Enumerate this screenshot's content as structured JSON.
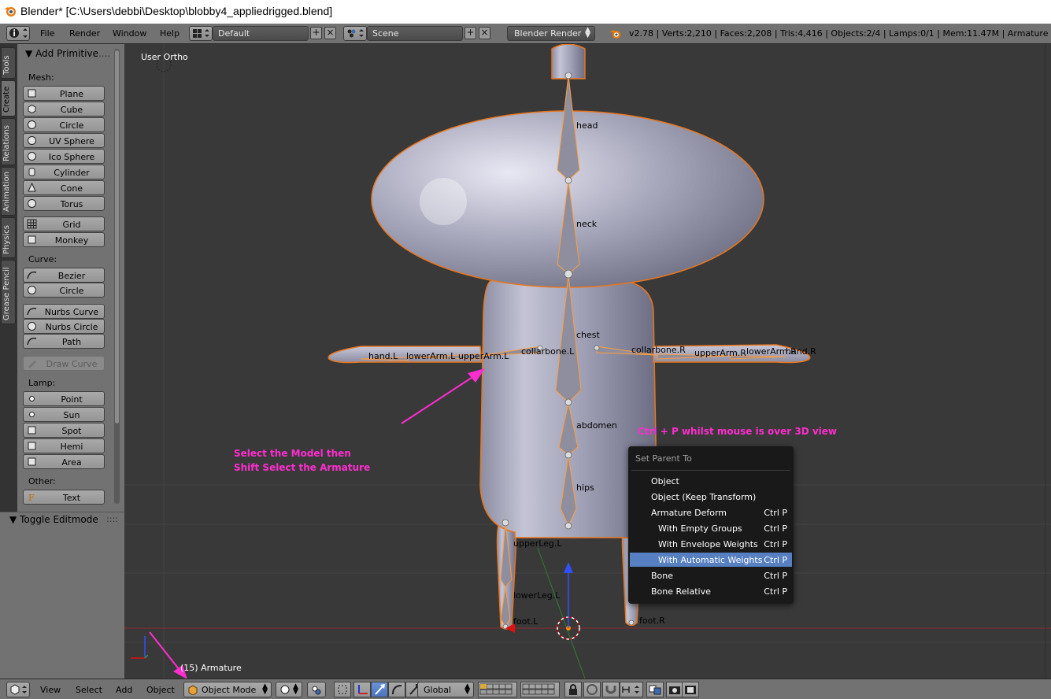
{
  "window": {
    "title": "Blender* [C:\\Users\\debbi\\Desktop\\blobby4_appliedrigged.blend]"
  },
  "info_header": {
    "menus": [
      "File",
      "Render",
      "Window",
      "Help"
    ],
    "layout": "Default",
    "scene": "Scene",
    "engine": "Blender Render",
    "stats": "v2.78 | Verts:2,210 | Faces:2,208 | Tris:4,416 | Objects:2/4 | Lamps:0/1 | Mem:11.47M | Armature"
  },
  "tabs": [
    "Tools",
    "Create",
    "Relations",
    "Animation",
    "Physics",
    "Grease Pencil"
  ],
  "active_tab": "Create",
  "tool_shelf": {
    "title": "Add Primitive",
    "title_suffix": "....",
    "groups": {
      "mesh": "Mesh:",
      "curve": "Curve:",
      "lamp": "Lamp:",
      "other": "Other:"
    },
    "mesh_buttons": [
      "Plane",
      "Cube",
      "Circle",
      "UV Sphere",
      "Ico Sphere",
      "Cylinder",
      "Cone",
      "Torus"
    ],
    "mesh_buttons2": [
      "Grid",
      "Monkey"
    ],
    "curve_buttons": [
      "Bezier",
      "Circle"
    ],
    "curve_buttons2": [
      "Nurbs Curve",
      "Nurbs Circle",
      "Path"
    ],
    "draw_curve": "Draw Curve",
    "lamp_buttons": [
      "Point",
      "Sun",
      "Spot",
      "Hemi",
      "Area"
    ],
    "other_buttons": [
      "Text"
    ],
    "toggle_editmode": "Toggle Editmode"
  },
  "viewport": {
    "view_label": "User Ortho",
    "object_label": "(15) Armature",
    "bones": {
      "head": "head",
      "neck": "neck",
      "chest": "chest",
      "abdomen": "abdomen",
      "hips": "hips",
      "hand_l": "hand.L",
      "lowerarm_l": "lowerArm.L",
      "upperarm_l": "upperArm.L",
      "collarbone_l": "collarbone.L",
      "collarbone_r": "collarbone.R",
      "upperarm_r": "upperArm.R",
      "lowerarm_r": "lowerArm.R",
      "hand_r": "hand.R",
      "upperleg_l": "upperLeg.L",
      "lowerleg_l": "lowerLeg.L",
      "foot_l": "foot.L",
      "foot_r": "foot.R"
    },
    "annotation_left_1": "Select the Model then",
    "annotation_left_2": "Shift Select the Armature",
    "annotation_right": "Ctrl + P whilst mouse is over 3D view",
    "annotation_color": "#ff2dd0"
  },
  "popup": {
    "title": "Set Parent To",
    "items": [
      {
        "label": "Object",
        "shortcut": ""
      },
      {
        "label": "Object (Keep Transform)",
        "shortcut": ""
      },
      {
        "label": "Armature Deform",
        "shortcut": "Ctrl P"
      },
      {
        "label": "With Empty Groups",
        "shortcut": "Ctrl P"
      },
      {
        "label": "With Envelope Weights",
        "shortcut": "Ctrl P"
      },
      {
        "label": "With Automatic Weights",
        "shortcut": "Ctrl P"
      },
      {
        "label": "Bone",
        "shortcut": "Ctrl P"
      },
      {
        "label": "Bone Relative",
        "shortcut": "Ctrl P"
      }
    ],
    "highlight_color": "#5680c2"
  },
  "bottom_bar": {
    "menus": [
      "View",
      "Select",
      "Add",
      "Object"
    ],
    "mode": "Object Mode",
    "orientation": "Global"
  },
  "icons": {
    "blender_logo": "blender-logo-icon",
    "info": "info-icon",
    "screen_layout": "layout-icon",
    "scene": "scene-icon",
    "render": "render-icon",
    "cube_mode": "object-mode-cube-icon"
  }
}
